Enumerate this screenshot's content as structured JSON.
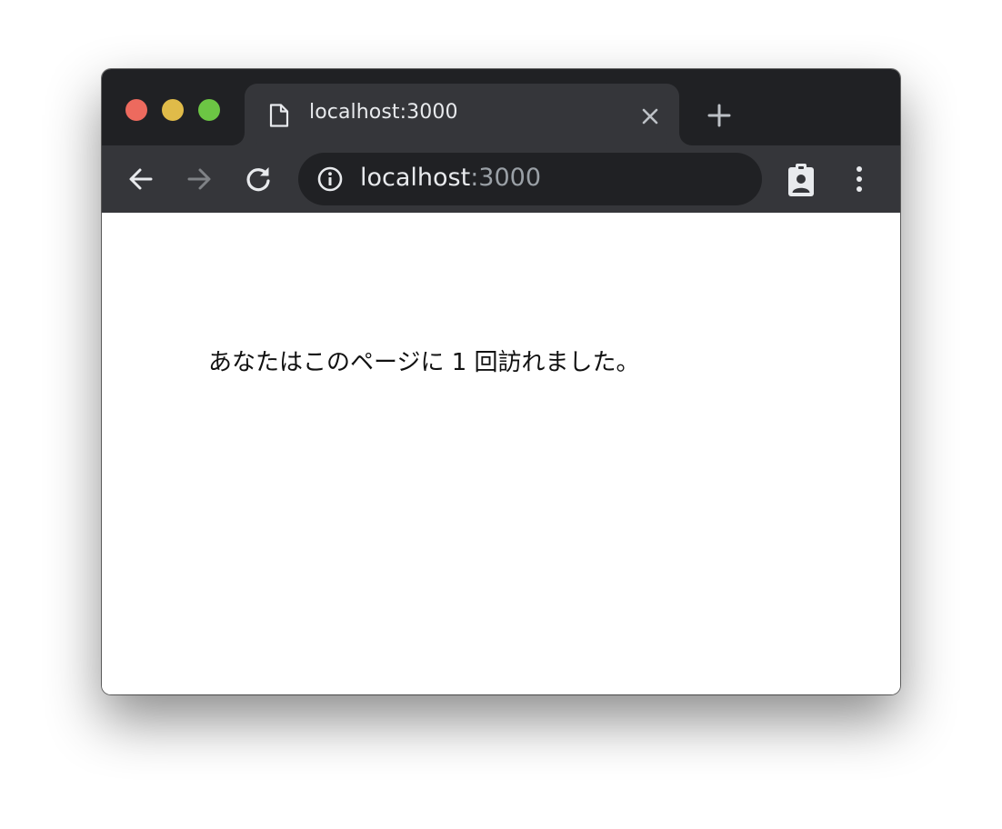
{
  "browser": {
    "tab": {
      "title": "localhost:3000",
      "favicon": "document-icon"
    },
    "toolbar": {
      "back_icon": "arrow-left-icon",
      "forward_icon": "arrow-right-icon",
      "reload_icon": "reload-icon",
      "address": {
        "host": "localhost",
        "port": ":3000",
        "security_icon": "info-icon"
      },
      "profile_icon": "clipboard-person-icon",
      "menu_icon": "kebab-menu-icon"
    },
    "colors": {
      "close": "#ed6a5e",
      "minimize": "#e0bb49",
      "maximize": "#6cc644",
      "tabstrip": "#202124",
      "toolbar": "#35363a"
    }
  },
  "page": {
    "message": "あなたはこのページに 1 回訪れました。"
  }
}
